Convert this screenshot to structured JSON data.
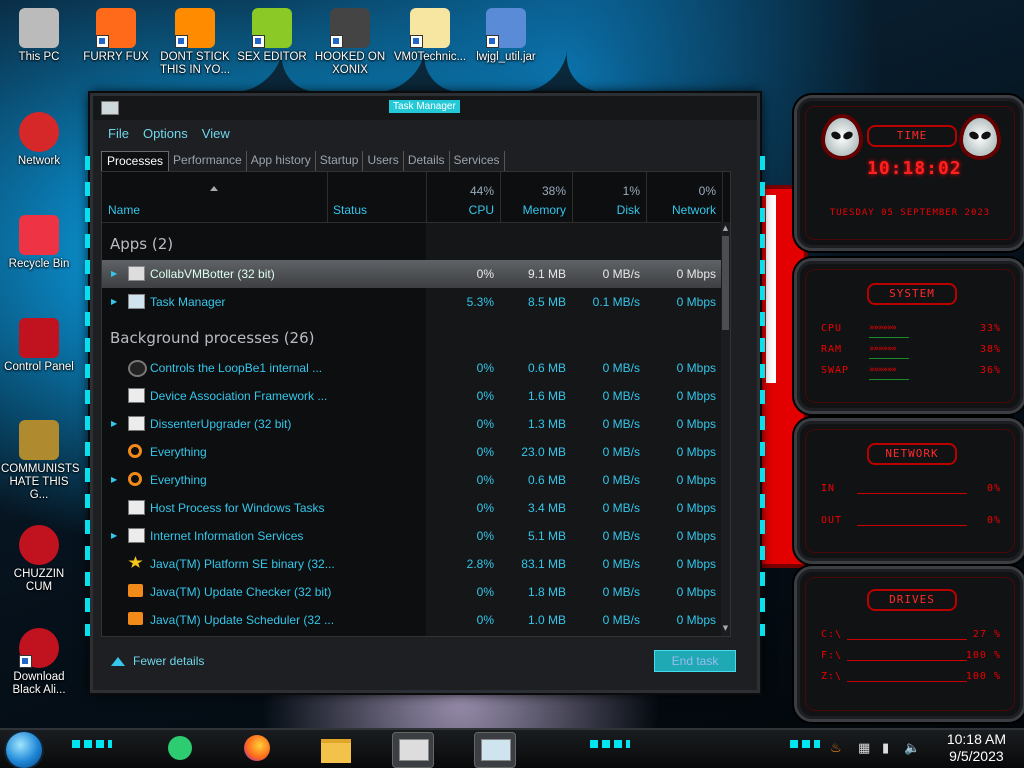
{
  "desktop": {
    "icons": [
      {
        "label": "This PC"
      },
      {
        "label": "FURRY FUX"
      },
      {
        "label": "DONT STICK THIS IN YO..."
      },
      {
        "label": "SEX EDITOR"
      },
      {
        "label": "HOOKED ON XONIX"
      },
      {
        "label": "VM0Technic..."
      },
      {
        "label": "lwjgl_util.jar"
      },
      {
        "label": "Network"
      },
      {
        "label": "Recycle Bin"
      },
      {
        "label": "Control Panel"
      },
      {
        "label": "COMMUNISTS HATE THIS G..."
      },
      {
        "label": "CHUZZIN CUM"
      },
      {
        "label": "Download Black Ali..."
      }
    ]
  },
  "task_manager": {
    "title": "Task Manager",
    "menu": [
      "File",
      "Options",
      "View"
    ],
    "tabs": [
      "Processes",
      "Performance",
      "App history",
      "Startup",
      "Users",
      "Details",
      "Services"
    ],
    "active_tab": "Processes",
    "columns": {
      "name": "Name",
      "status": "Status",
      "cpu": {
        "label": "CPU",
        "pct": "44%"
      },
      "memory": {
        "label": "Memory",
        "pct": "38%"
      },
      "disk": {
        "label": "Disk",
        "pct": "1%"
      },
      "network": {
        "label": "Network",
        "pct": "0%"
      }
    },
    "apps_header": "Apps (2)",
    "apps": [
      {
        "name": "CollabVMBotter (32 bit)",
        "cpu": "0%",
        "memory": "9.1 MB",
        "disk": "0 MB/s",
        "network": "0 Mbps",
        "expandable": true,
        "icon": "paint-app-icon",
        "selected": true
      },
      {
        "name": "Task Manager",
        "cpu": "5.3%",
        "memory": "8.5 MB",
        "disk": "0.1 MB/s",
        "network": "0 Mbps",
        "expandable": true,
        "icon": "task-manager-icon",
        "selected": false
      }
    ],
    "bg_header": "Background processes (26)",
    "background": [
      {
        "name": "Controls the LoopBe1 internal ...",
        "cpu": "0%",
        "memory": "0.6 MB",
        "disk": "0 MB/s",
        "network": "0 Mbps",
        "expandable": false,
        "icon": "loopbe-icon"
      },
      {
        "name": "Device Association Framework ...",
        "cpu": "0%",
        "memory": "1.6 MB",
        "disk": "0 MB/s",
        "network": "0 Mbps",
        "expandable": false,
        "icon": "window-process-icon"
      },
      {
        "name": "DissenterUpgrader (32 bit)",
        "cpu": "0%",
        "memory": "1.3 MB",
        "disk": "0 MB/s",
        "network": "0 Mbps",
        "expandable": true,
        "icon": "window-process-icon"
      },
      {
        "name": "Everything",
        "cpu": "0%",
        "memory": "23.0 MB",
        "disk": "0 MB/s",
        "network": "0 Mbps",
        "expandable": false,
        "icon": "magnifier-icon"
      },
      {
        "name": "Everything",
        "cpu": "0%",
        "memory": "0.6 MB",
        "disk": "0 MB/s",
        "network": "0 Mbps",
        "expandable": true,
        "icon": "magnifier-icon"
      },
      {
        "name": "Host Process for Windows Tasks",
        "cpu": "0%",
        "memory": "3.4 MB",
        "disk": "0 MB/s",
        "network": "0 Mbps",
        "expandable": false,
        "icon": "window-process-icon"
      },
      {
        "name": "Internet Information Services",
        "cpu": "0%",
        "memory": "5.1 MB",
        "disk": "0 MB/s",
        "network": "0 Mbps",
        "expandable": true,
        "icon": "window-process-icon"
      },
      {
        "name": "Java(TM) Platform SE binary (32...",
        "cpu": "2.8%",
        "memory": "83.1 MB",
        "disk": "0 MB/s",
        "network": "0 Mbps",
        "expandable": false,
        "icon": "java-star-icon"
      },
      {
        "name": "Java(TM) Update Checker (32 bit)",
        "cpu": "0%",
        "memory": "1.8 MB",
        "disk": "0 MB/s",
        "network": "0 Mbps",
        "expandable": false,
        "icon": "java-update-icon"
      },
      {
        "name": "Java(TM) Update Scheduler (32 ...",
        "cpu": "0%",
        "memory": "1.0 MB",
        "disk": "0 MB/s",
        "network": "0 Mbps",
        "expandable": false,
        "icon": "java-update-icon"
      }
    ],
    "fewer_details": "Fewer details",
    "end_task": "End task"
  },
  "widgets": {
    "time": {
      "title": "TIME",
      "clock": "10:18:02",
      "date": "TUESDAY 05 SEPTEMBER 2023"
    },
    "system": {
      "title": "SYSTEM",
      "rows": [
        {
          "label": "CPU",
          "value": "33%"
        },
        {
          "label": "RAM",
          "value": "38%"
        },
        {
          "label": "SWAP",
          "value": "36%"
        }
      ]
    },
    "network": {
      "title": "NETWORK",
      "rows": [
        {
          "label": "IN",
          "value": "0%"
        },
        {
          "label": "OUT",
          "value": "0%"
        }
      ]
    },
    "drives": {
      "title": "DRIVES",
      "rows": [
        {
          "label": "C:\\",
          "value": "27 %"
        },
        {
          "label": "F:\\",
          "value": "100 %"
        },
        {
          "label": "Z:\\",
          "value": "100 %"
        }
      ]
    }
  },
  "taskbar": {
    "time": "10:18 AM",
    "date": "9/5/2023",
    "colors": {
      "accent": "#00e5f0",
      "widget_red": "#ff2020"
    }
  }
}
